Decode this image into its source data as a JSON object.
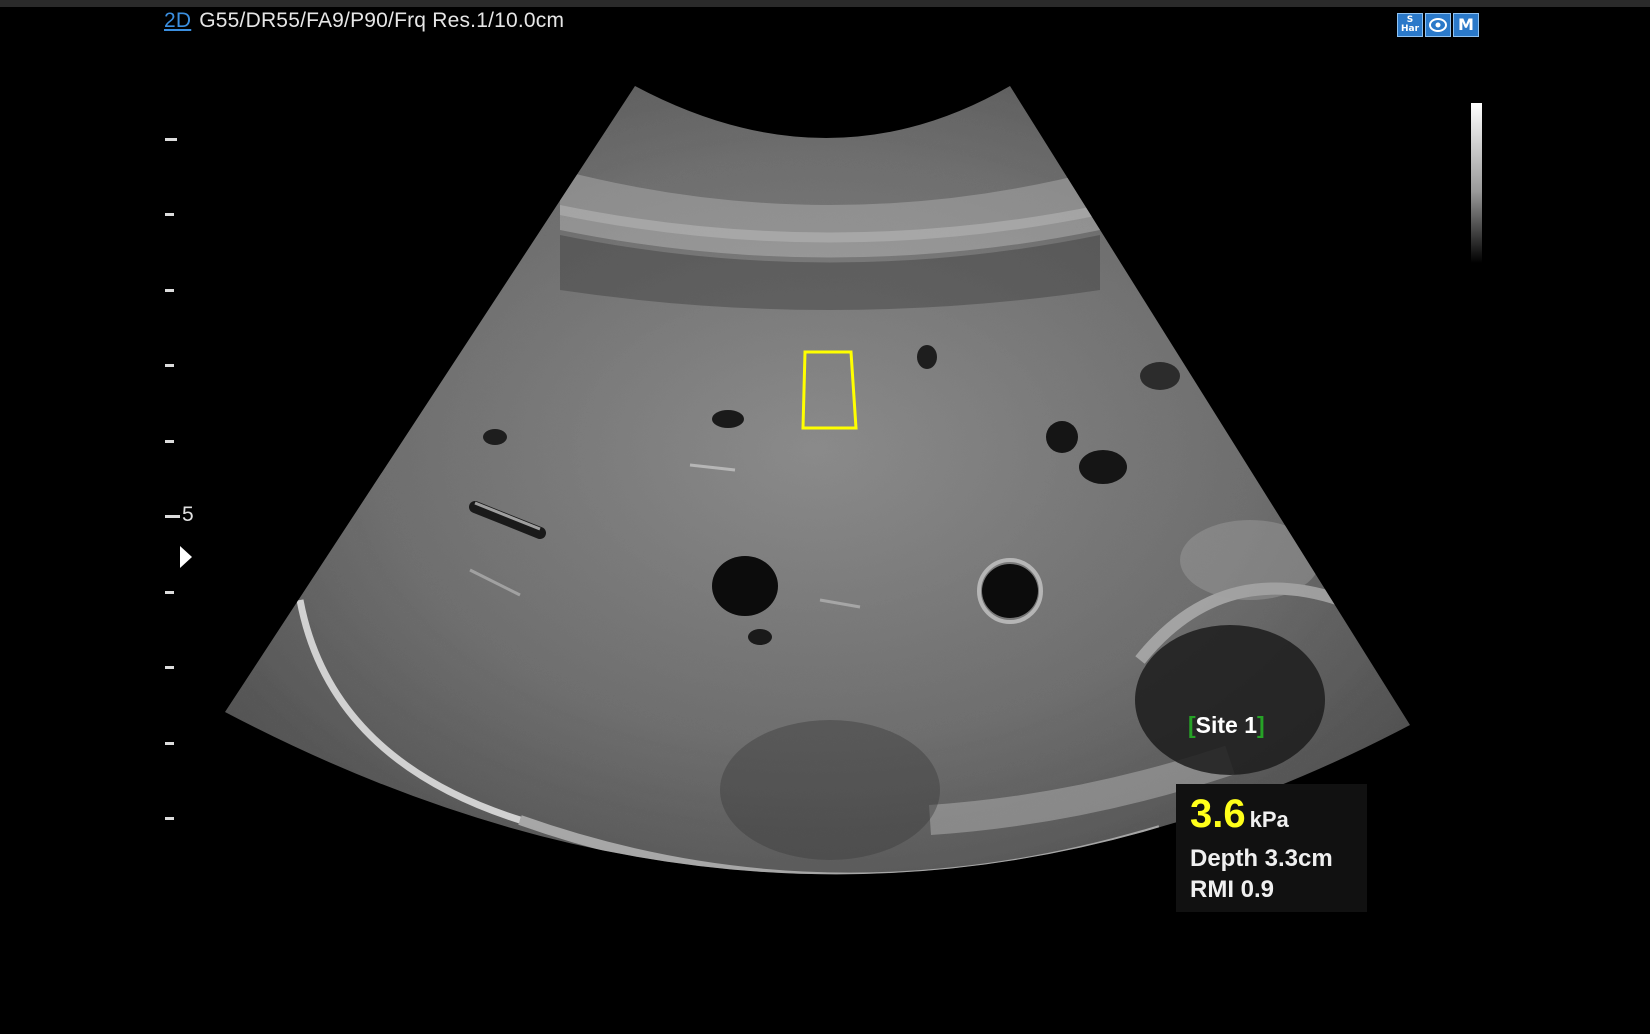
{
  "header": {
    "mode": "2D",
    "params": "G55/DR55/FA9/P90/Frq Res.1/10.0cm"
  },
  "status_icons": [
    {
      "icon": "s-har-icon",
      "text": "S\nHar"
    },
    {
      "icon": "probe-icon",
      "text": "◉"
    },
    {
      "icon": "m-icon",
      "text": "M"
    }
  ],
  "depth_scale": {
    "label_5": "5"
  },
  "roi": {
    "color": "#ffff00"
  },
  "site": {
    "open": "[",
    "label": "Site 1",
    "close": "]"
  },
  "result": {
    "value": "3.6",
    "unit": "kPa",
    "depth": "Depth 3.3cm",
    "rmi": "RMI 0.9"
  },
  "colors": {
    "accent": "#3b8fe0",
    "value_yellow": "#ffff1a",
    "bracket_green": "#26a226"
  }
}
